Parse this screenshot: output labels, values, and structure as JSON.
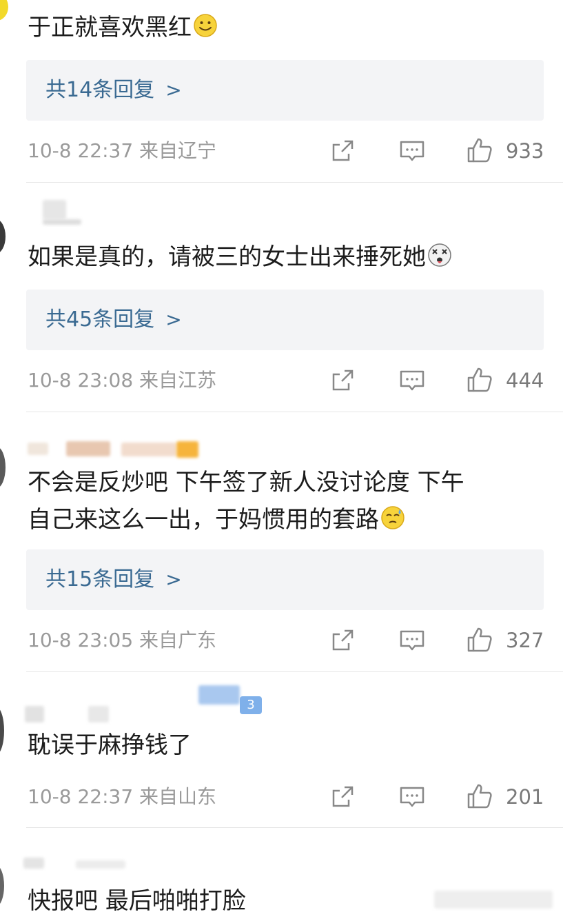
{
  "comments": [
    {
      "text": "于正就喜欢黑红",
      "emoji": "smile-emoji",
      "replies": "共14条回复",
      "date": "10-8 22:37",
      "location": "来自辽宁",
      "likes": "933"
    },
    {
      "text": "如果是真的，请被三的女士出来捶死她",
      "emoji": "dizzy-face-emoji",
      "replies": "共45条回复",
      "date": "10-8 23:08",
      "location": "来自江苏",
      "likes": "444"
    },
    {
      "text_line1": "不会是反炒吧 下午签了新人没讨论度 下午",
      "text_line2": "自己来这么一出，于妈惯用的套路",
      "emoji": "sweat-face-emoji",
      "replies": "共15条回复",
      "date": "10-8 23:05",
      "location": "来自广东",
      "likes": "327"
    },
    {
      "badge": "3",
      "text": "耽误于麻挣钱了",
      "date": "10-8 22:37",
      "location": "来自山东",
      "likes": "201"
    },
    {
      "text": "快报吧 最后啪啪打脸"
    }
  ],
  "icons": {
    "share": "share-icon",
    "comment": "comment-icon",
    "like": "thumbs-up-icon"
  },
  "colors": {
    "reply_link": "#3a6a92",
    "meta_text": "#9a9a9a",
    "reply_bg": "#f3f4f6"
  }
}
